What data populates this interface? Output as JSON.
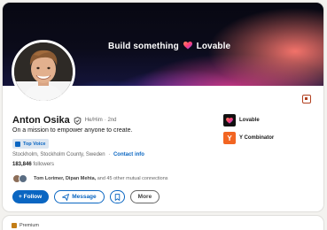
{
  "banner": {
    "text_prefix": "Build something",
    "brand": "Lovable"
  },
  "profile": {
    "name": "Anton Osika",
    "pronouns": "He/Him",
    "degree": "· 2nd",
    "headline": "On a mission to empower anyone to create.",
    "badge": "Top Voice",
    "location": "Stockholm, Stockholm County, Sweden",
    "separator": "·",
    "contact_info": "Contact info",
    "followers_count": "183,846",
    "followers_label": "followers",
    "mutual_names": "Tom Lorimer, Dipan Mehta,",
    "mutual_rest": "and 45 other mutual connections"
  },
  "actions": {
    "follow": "+ Follow",
    "message": "Message",
    "more": "More"
  },
  "organizations": [
    {
      "name": "Lovable",
      "icon": "lovable-logo"
    },
    {
      "name": "Y Combinator",
      "icon": "y-combinator-logo",
      "letter": "Y"
    }
  ],
  "next_card": {
    "premium": "Premium"
  },
  "colors": {
    "link_blue": "#0a66c2",
    "badge_bg": "#dce6f1",
    "yc_orange": "#f26522",
    "premium_gold": "#c37d16"
  }
}
